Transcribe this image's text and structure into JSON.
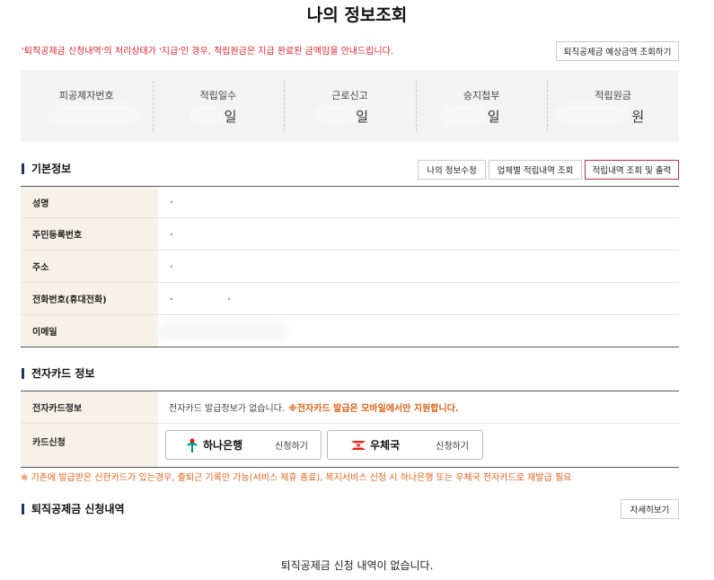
{
  "header": {
    "title": "나의 정보조회"
  },
  "notice": {
    "text": "'퇴직공제금 신청내역'의 처리상태가 '지급'인 경우, 적립원금은 지급 완료된 금액임을 안내드립니다.",
    "estimate_button": "퇴직공제금 예상금액 조회하기"
  },
  "summary": [
    {
      "label": "피공제자번호",
      "unit": ""
    },
    {
      "label": "적립일수",
      "unit": "일"
    },
    {
      "label": "근로신고",
      "unit": "일"
    },
    {
      "label": "승지첩부",
      "unit": "일"
    },
    {
      "label": "적립원금",
      "unit": "원"
    }
  ],
  "basic_info": {
    "title": "기본정보",
    "buttons": {
      "edit": "나의 정보수정",
      "by_company": "업체별 적립내역 조회",
      "print": "적립내역 조회 및 출력"
    },
    "rows": [
      {
        "label": "성명"
      },
      {
        "label": "주민등록번호"
      },
      {
        "label": "주소"
      },
      {
        "label": "전화번호(휴대전화)"
      },
      {
        "label": "이메일"
      }
    ]
  },
  "ecard": {
    "title": "전자카드 정보",
    "info_label": "전자카드정보",
    "info_text": "전자카드 발급정보가 없습니다.",
    "info_note": "※전자카드 발급은 모바일에서만 지원합니다.",
    "apply_label": "카드신청",
    "banks": [
      {
        "name": "하나은행",
        "action": "신청하기",
        "logo_color": "#008e8e"
      },
      {
        "name": "우체국",
        "action": "신청하기",
        "logo_color": "#e2231a"
      }
    ],
    "warning": "※ 기존에 발급받은 신한카드가 있는경우, 출퇴근 기록만 가능(서비스 제휴 종료), 복지서비스 신청 시 하나은행 또는 우체국 전자카드로 재발급 필요"
  },
  "retirement": {
    "title": "퇴직공제금 신청내역",
    "detail_button": "자세히보기",
    "empty_text": "퇴직공제금 신청 내역이 없습니다."
  }
}
